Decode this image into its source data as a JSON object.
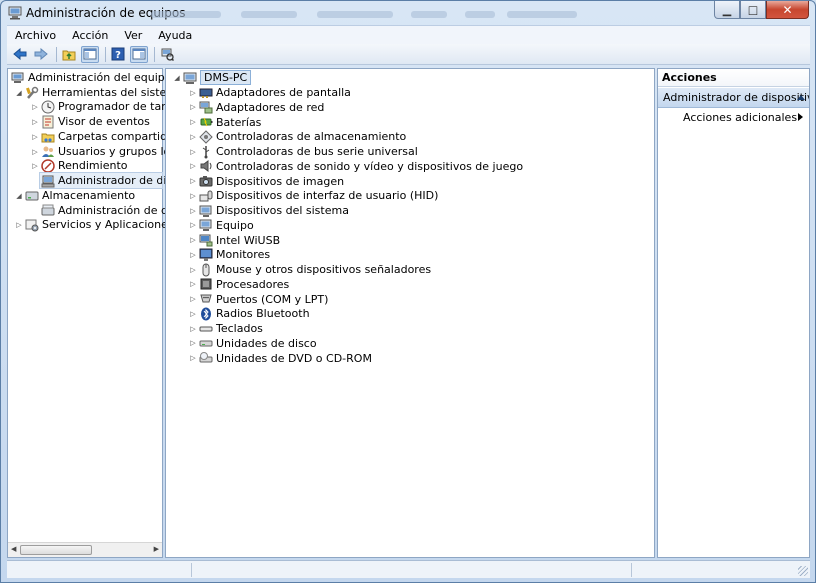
{
  "window": {
    "title": "Administración de equipos"
  },
  "menu": [
    {
      "label": "Archivo"
    },
    {
      "label": "Acción"
    },
    {
      "label": "Ver"
    },
    {
      "label": "Ayuda"
    }
  ],
  "toolbar": {
    "buttons": [
      {
        "icon": "back-arrow-icon"
      },
      {
        "icon": "forward-arrow-icon"
      },
      {
        "icon": "up-folder-icon"
      },
      {
        "icon": "show-hide-console-tree-icon"
      },
      {
        "icon": "help-icon"
      },
      {
        "icon": "show-hide-action-pane-icon"
      },
      {
        "icon": "scan-hardware-icon"
      }
    ]
  },
  "left_tree": {
    "root": "Administración del equipo (loc",
    "system_tools": "Herramientas del sistema",
    "task_scheduler": "Programador de tareas",
    "event_viewer": "Visor de eventos",
    "shared_folders": "Carpetas compartidas",
    "local_users": "Usuarios y grupos locale",
    "performance": "Rendimiento",
    "device_manager": "Administrador de dispo",
    "storage": "Almacenamiento",
    "disk_management": "Administración de disco",
    "services": "Servicios y Aplicaciones"
  },
  "device_tree": {
    "computer": "DMS-PC",
    "categories": [
      {
        "label": "Adaptadores de pantalla",
        "icon": "display-adapter-icon"
      },
      {
        "label": "Adaptadores de red",
        "icon": "network-adapter-icon"
      },
      {
        "label": "Baterías",
        "icon": "battery-icon"
      },
      {
        "label": "Controladoras de almacenamiento",
        "icon": "storage-controller-icon"
      },
      {
        "label": "Controladoras de bus serie universal",
        "icon": "usb-icon"
      },
      {
        "label": "Controladoras de sonido y vídeo y dispositivos de juego",
        "icon": "sound-icon"
      },
      {
        "label": "Dispositivos de imagen",
        "icon": "camera-icon"
      },
      {
        "label": "Dispositivos de interfaz de usuario (HID)",
        "icon": "hid-icon"
      },
      {
        "label": "Dispositivos del sistema",
        "icon": "system-device-icon"
      },
      {
        "label": "Equipo",
        "icon": "computer-icon"
      },
      {
        "label": "Intel WiUSB",
        "icon": "wiusb-icon"
      },
      {
        "label": "Monitores",
        "icon": "monitor-icon"
      },
      {
        "label": "Mouse y otros dispositivos señaladores",
        "icon": "mouse-icon"
      },
      {
        "label": "Procesadores",
        "icon": "processor-icon"
      },
      {
        "label": "Puertos (COM y LPT)",
        "icon": "port-icon"
      },
      {
        "label": "Radios Bluetooth",
        "icon": "bluetooth-icon"
      },
      {
        "label": "Teclados",
        "icon": "keyboard-icon"
      },
      {
        "label": "Unidades de disco",
        "icon": "disk-drive-icon"
      },
      {
        "label": "Unidades de DVD o CD-ROM",
        "icon": "dvd-drive-icon"
      }
    ]
  },
  "actions": {
    "header": "Acciones",
    "section": "Administrador de dispositivos",
    "more": "Acciones adicionales"
  },
  "colors": {
    "accent": "#1d3f6e",
    "selection": "#c3d7ee"
  }
}
